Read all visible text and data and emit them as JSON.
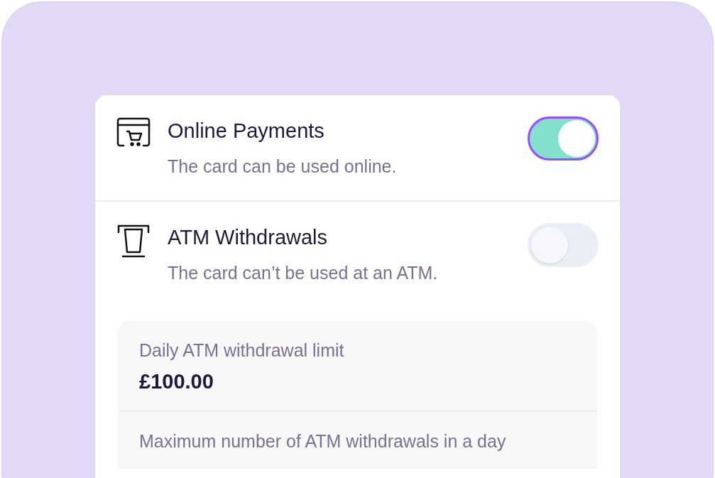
{
  "settings": [
    {
      "kind": "cart",
      "title": "Online Payments",
      "description": "The card can be used online.",
      "on": true
    },
    {
      "kind": "atm",
      "title": "ATM Withdrawals",
      "description": "The card can’t be used at an ATM.",
      "on": false
    }
  ],
  "limits": [
    {
      "label": "Daily ATM withdrawal limit",
      "value": "£100.00"
    },
    {
      "label": "Maximum number of ATM withdrawals in a day"
    }
  ]
}
